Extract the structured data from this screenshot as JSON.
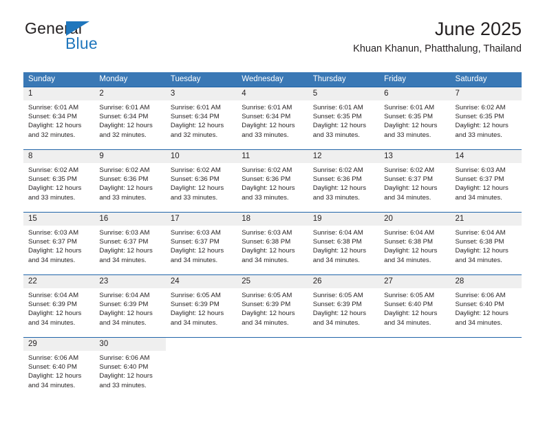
{
  "brand": {
    "name_primary": "General",
    "name_secondary": "Blue",
    "flag_icon": "triangle-flag-icon",
    "accent_color": "#1f76bc"
  },
  "header": {
    "month_title": "June 2025",
    "location": "Khuan Khanun, Phatthalung, Thailand"
  },
  "theme": {
    "header_row_background": "#3a78b5",
    "header_row_text": "#ffffff",
    "row_divider": "#1f63a8",
    "daynum_band_background": "#efefef",
    "body_text": "#231f20"
  },
  "calendar": {
    "weekday_headers": [
      "Sunday",
      "Monday",
      "Tuesday",
      "Wednesday",
      "Thursday",
      "Friday",
      "Saturday"
    ],
    "weeks": [
      [
        {
          "day": "1",
          "lines": [
            "Sunrise: 6:01 AM",
            "Sunset: 6:34 PM",
            "Daylight: 12 hours",
            "and 32 minutes."
          ]
        },
        {
          "day": "2",
          "lines": [
            "Sunrise: 6:01 AM",
            "Sunset: 6:34 PM",
            "Daylight: 12 hours",
            "and 32 minutes."
          ]
        },
        {
          "day": "3",
          "lines": [
            "Sunrise: 6:01 AM",
            "Sunset: 6:34 PM",
            "Daylight: 12 hours",
            "and 32 minutes."
          ]
        },
        {
          "day": "4",
          "lines": [
            "Sunrise: 6:01 AM",
            "Sunset: 6:34 PM",
            "Daylight: 12 hours",
            "and 33 minutes."
          ]
        },
        {
          "day": "5",
          "lines": [
            "Sunrise: 6:01 AM",
            "Sunset: 6:35 PM",
            "Daylight: 12 hours",
            "and 33 minutes."
          ]
        },
        {
          "day": "6",
          "lines": [
            "Sunrise: 6:01 AM",
            "Sunset: 6:35 PM",
            "Daylight: 12 hours",
            "and 33 minutes."
          ]
        },
        {
          "day": "7",
          "lines": [
            "Sunrise: 6:02 AM",
            "Sunset: 6:35 PM",
            "Daylight: 12 hours",
            "and 33 minutes."
          ]
        }
      ],
      [
        {
          "day": "8",
          "lines": [
            "Sunrise: 6:02 AM",
            "Sunset: 6:35 PM",
            "Daylight: 12 hours",
            "and 33 minutes."
          ]
        },
        {
          "day": "9",
          "lines": [
            "Sunrise: 6:02 AM",
            "Sunset: 6:36 PM",
            "Daylight: 12 hours",
            "and 33 minutes."
          ]
        },
        {
          "day": "10",
          "lines": [
            "Sunrise: 6:02 AM",
            "Sunset: 6:36 PM",
            "Daylight: 12 hours",
            "and 33 minutes."
          ]
        },
        {
          "day": "11",
          "lines": [
            "Sunrise: 6:02 AM",
            "Sunset: 6:36 PM",
            "Daylight: 12 hours",
            "and 33 minutes."
          ]
        },
        {
          "day": "12",
          "lines": [
            "Sunrise: 6:02 AM",
            "Sunset: 6:36 PM",
            "Daylight: 12 hours",
            "and 33 minutes."
          ]
        },
        {
          "day": "13",
          "lines": [
            "Sunrise: 6:02 AM",
            "Sunset: 6:37 PM",
            "Daylight: 12 hours",
            "and 34 minutes."
          ]
        },
        {
          "day": "14",
          "lines": [
            "Sunrise: 6:03 AM",
            "Sunset: 6:37 PM",
            "Daylight: 12 hours",
            "and 34 minutes."
          ]
        }
      ],
      [
        {
          "day": "15",
          "lines": [
            "Sunrise: 6:03 AM",
            "Sunset: 6:37 PM",
            "Daylight: 12 hours",
            "and 34 minutes."
          ]
        },
        {
          "day": "16",
          "lines": [
            "Sunrise: 6:03 AM",
            "Sunset: 6:37 PM",
            "Daylight: 12 hours",
            "and 34 minutes."
          ]
        },
        {
          "day": "17",
          "lines": [
            "Sunrise: 6:03 AM",
            "Sunset: 6:37 PM",
            "Daylight: 12 hours",
            "and 34 minutes."
          ]
        },
        {
          "day": "18",
          "lines": [
            "Sunrise: 6:03 AM",
            "Sunset: 6:38 PM",
            "Daylight: 12 hours",
            "and 34 minutes."
          ]
        },
        {
          "day": "19",
          "lines": [
            "Sunrise: 6:04 AM",
            "Sunset: 6:38 PM",
            "Daylight: 12 hours",
            "and 34 minutes."
          ]
        },
        {
          "day": "20",
          "lines": [
            "Sunrise: 6:04 AM",
            "Sunset: 6:38 PM",
            "Daylight: 12 hours",
            "and 34 minutes."
          ]
        },
        {
          "day": "21",
          "lines": [
            "Sunrise: 6:04 AM",
            "Sunset: 6:38 PM",
            "Daylight: 12 hours",
            "and 34 minutes."
          ]
        }
      ],
      [
        {
          "day": "22",
          "lines": [
            "Sunrise: 6:04 AM",
            "Sunset: 6:39 PM",
            "Daylight: 12 hours",
            "and 34 minutes."
          ]
        },
        {
          "day": "23",
          "lines": [
            "Sunrise: 6:04 AM",
            "Sunset: 6:39 PM",
            "Daylight: 12 hours",
            "and 34 minutes."
          ]
        },
        {
          "day": "24",
          "lines": [
            "Sunrise: 6:05 AM",
            "Sunset: 6:39 PM",
            "Daylight: 12 hours",
            "and 34 minutes."
          ]
        },
        {
          "day": "25",
          "lines": [
            "Sunrise: 6:05 AM",
            "Sunset: 6:39 PM",
            "Daylight: 12 hours",
            "and 34 minutes."
          ]
        },
        {
          "day": "26",
          "lines": [
            "Sunrise: 6:05 AM",
            "Sunset: 6:39 PM",
            "Daylight: 12 hours",
            "and 34 minutes."
          ]
        },
        {
          "day": "27",
          "lines": [
            "Sunrise: 6:05 AM",
            "Sunset: 6:40 PM",
            "Daylight: 12 hours",
            "and 34 minutes."
          ]
        },
        {
          "day": "28",
          "lines": [
            "Sunrise: 6:06 AM",
            "Sunset: 6:40 PM",
            "Daylight: 12 hours",
            "and 34 minutes."
          ]
        }
      ],
      [
        {
          "day": "29",
          "lines": [
            "Sunrise: 6:06 AM",
            "Sunset: 6:40 PM",
            "Daylight: 12 hours",
            "and 34 minutes."
          ]
        },
        {
          "day": "30",
          "lines": [
            "Sunrise: 6:06 AM",
            "Sunset: 6:40 PM",
            "Daylight: 12 hours",
            "and 33 minutes."
          ]
        },
        {
          "day": "",
          "lines": []
        },
        {
          "day": "",
          "lines": []
        },
        {
          "day": "",
          "lines": []
        },
        {
          "day": "",
          "lines": []
        },
        {
          "day": "",
          "lines": []
        }
      ]
    ]
  }
}
